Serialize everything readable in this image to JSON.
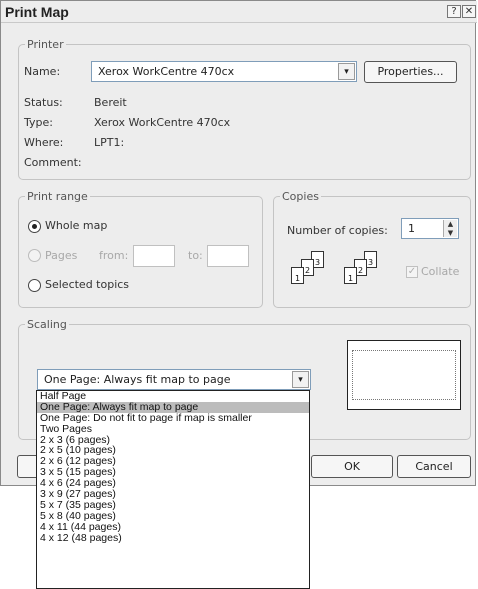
{
  "window": {
    "title": "Print Map",
    "help_glyph": "?",
    "close_glyph": "✕"
  },
  "printer": {
    "legend": "Printer",
    "name_label": "Name:",
    "name_value": "Xerox WorkCentre 470cx",
    "properties_button": "Properties...",
    "status_label": "Status:",
    "status_value": "Bereit",
    "type_label": "Type:",
    "type_value": "Xerox WorkCentre 470cx",
    "where_label": "Where:",
    "where_value": "LPT1:",
    "comment_label": "Comment:"
  },
  "print_range": {
    "legend": "Print range",
    "whole_map": "Whole map",
    "pages": "Pages",
    "from_label": "from:",
    "to_label": "to:",
    "selected_topics": "Selected topics",
    "selected_option": "Whole map"
  },
  "copies": {
    "legend": "Copies",
    "number_label": "Number of copies:",
    "number_value": "1",
    "collate_label": "Collate",
    "collate_checked": true,
    "page_numbers": [
      "1",
      "2",
      "3"
    ]
  },
  "scaling": {
    "legend": "Scaling",
    "selected": "One Page: Always fit map to page",
    "options": [
      "Half Page",
      "One Page: Always fit map to page",
      "One Page: Do not fit to page if map is smaller",
      "Two Pages",
      "2 x 3 (6 pages)",
      "2 x 5 (10 pages)",
      "2 x 6 (12 pages)",
      "3 x 5 (15 pages)",
      "4 x 6 (24 pages)",
      "3 x 9 (27 pages)",
      "5 x 7 (35 pages)",
      "5 x 8 (40 pages)",
      "4 x 11 (44 pages)",
      "4 x 12 (48 pages)"
    ],
    "highlighted_index": 1
  },
  "footer": {
    "ok_button": "OK",
    "cancel_button": "Cancel"
  },
  "icons": {
    "dropdown_arrow": "▾",
    "spin_up": "▲",
    "spin_down": "▼",
    "checkmark": "✓"
  }
}
